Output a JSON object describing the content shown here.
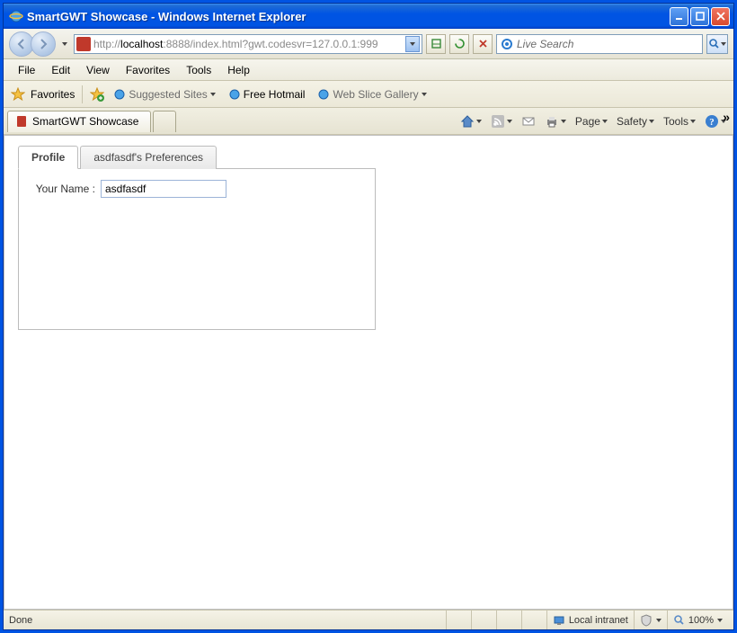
{
  "window": {
    "title": "SmartGWT Showcase - Windows Internet Explorer"
  },
  "address": {
    "prefix": "http://",
    "host": "localhost",
    "rest": ":8888/index.html?gwt.codesvr=127.0.0.1:999"
  },
  "search": {
    "placeholder": "Live Search"
  },
  "menu": {
    "file": "File",
    "edit": "Edit",
    "view": "View",
    "favorites": "Favorites",
    "tools": "Tools",
    "help": "Help"
  },
  "favbar": {
    "favorites": "Favorites",
    "suggested": "Suggested Sites",
    "hotmail": "Free Hotmail",
    "slice": "Web Slice Gallery"
  },
  "tabs": {
    "page": "SmartGWT Showcase"
  },
  "cmdbar": {
    "page": "Page",
    "safety": "Safety",
    "tools": "Tools"
  },
  "content": {
    "tabs": {
      "profile": "Profile",
      "prefs": "asdfasdf's Preferences"
    },
    "form": {
      "label": "Your Name :",
      "value": "asdfasdf"
    }
  },
  "status": {
    "done": "Done",
    "zone": "Local intranet",
    "zoom": "100%"
  }
}
